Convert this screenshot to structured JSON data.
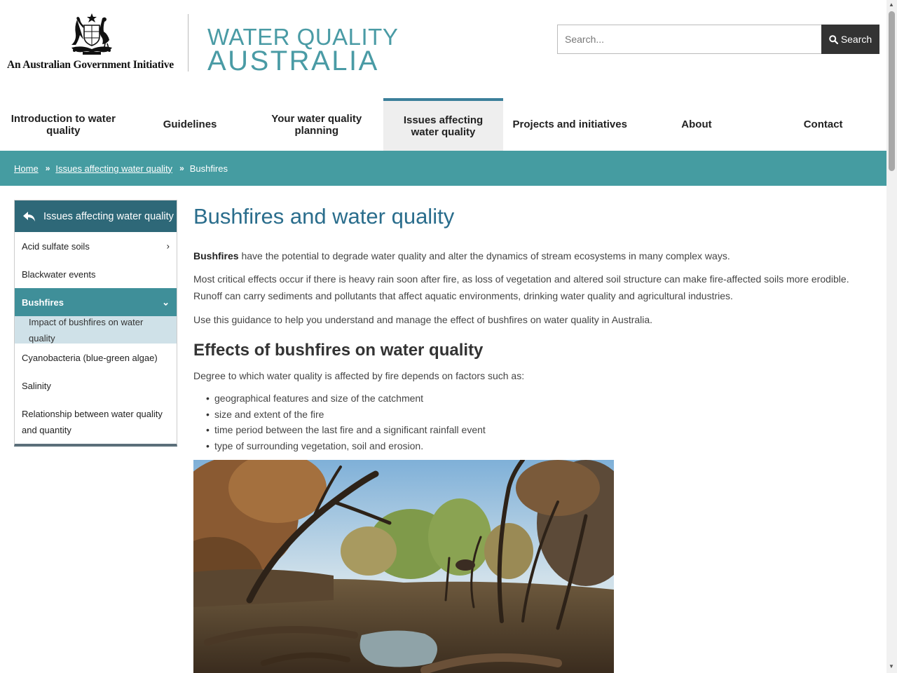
{
  "header": {
    "agency_text": "An Australian Government Initiative",
    "logo_line1": "WATER QUALITY",
    "logo_line2": "AUSTRALIA",
    "search_placeholder": "Search...",
    "search_button": "Search"
  },
  "nav": {
    "items": [
      {
        "label": "Introduction to water quality"
      },
      {
        "label": "Guidelines"
      },
      {
        "label": "Your water quality planning"
      },
      {
        "label": "Issues affecting water quality"
      },
      {
        "label": "Projects and initiatives"
      },
      {
        "label": "About"
      },
      {
        "label": "Contact"
      }
    ]
  },
  "breadcrumb": {
    "home": "Home",
    "parent": "Issues affecting water quality",
    "current": "Bushfires"
  },
  "sidebar": {
    "heading": "Issues affecting water quality",
    "items": [
      {
        "label": "Acid sulfate soils"
      },
      {
        "label": "Blackwater events"
      },
      {
        "label": "Bushfires"
      },
      {
        "label": "Impact of bushfires on water quality"
      },
      {
        "label": "Cyanobacteria (blue-green algae)"
      },
      {
        "label": "Salinity"
      },
      {
        "label": "Relationship between water quality and quantity"
      }
    ]
  },
  "main": {
    "title": "Bushfires and water quality",
    "intro_bold": "Bushfires",
    "intro_rest": " have the potential to degrade water quality and alter the dynamics of stream ecosystems in many complex ways.",
    "para2": "Most critical effects occur if there is heavy rain soon after fire, as loss of vegetation and altered soil structure can make fire-affected soils more erodible. Runoff can carry sediments and pollutants that affect aquatic environments, drinking water quality and agricultural industries.",
    "para3": "Use this guidance to help you understand and manage the effect of bushfires on water quality in Australia.",
    "section_heading": "Effects of bushfires on water quality",
    "section_intro": "Degree to which water quality is affected by fire depends on factors such as:",
    "factors": [
      "geographical features and size of the catchment",
      "size and extent of the fire",
      "time period between the last fire and a significant rainfall event",
      "type of surrounding vegetation, soil and erosion."
    ]
  },
  "colors": {
    "teal": "#459ca1",
    "sidebar_head": "#2e6878",
    "title_blue": "#2a6d8c",
    "logo": "#4a9ba5"
  },
  "icons": {
    "search": "search-icon",
    "back": "back-arrow-icon",
    "chevron": "chevron-icon"
  }
}
